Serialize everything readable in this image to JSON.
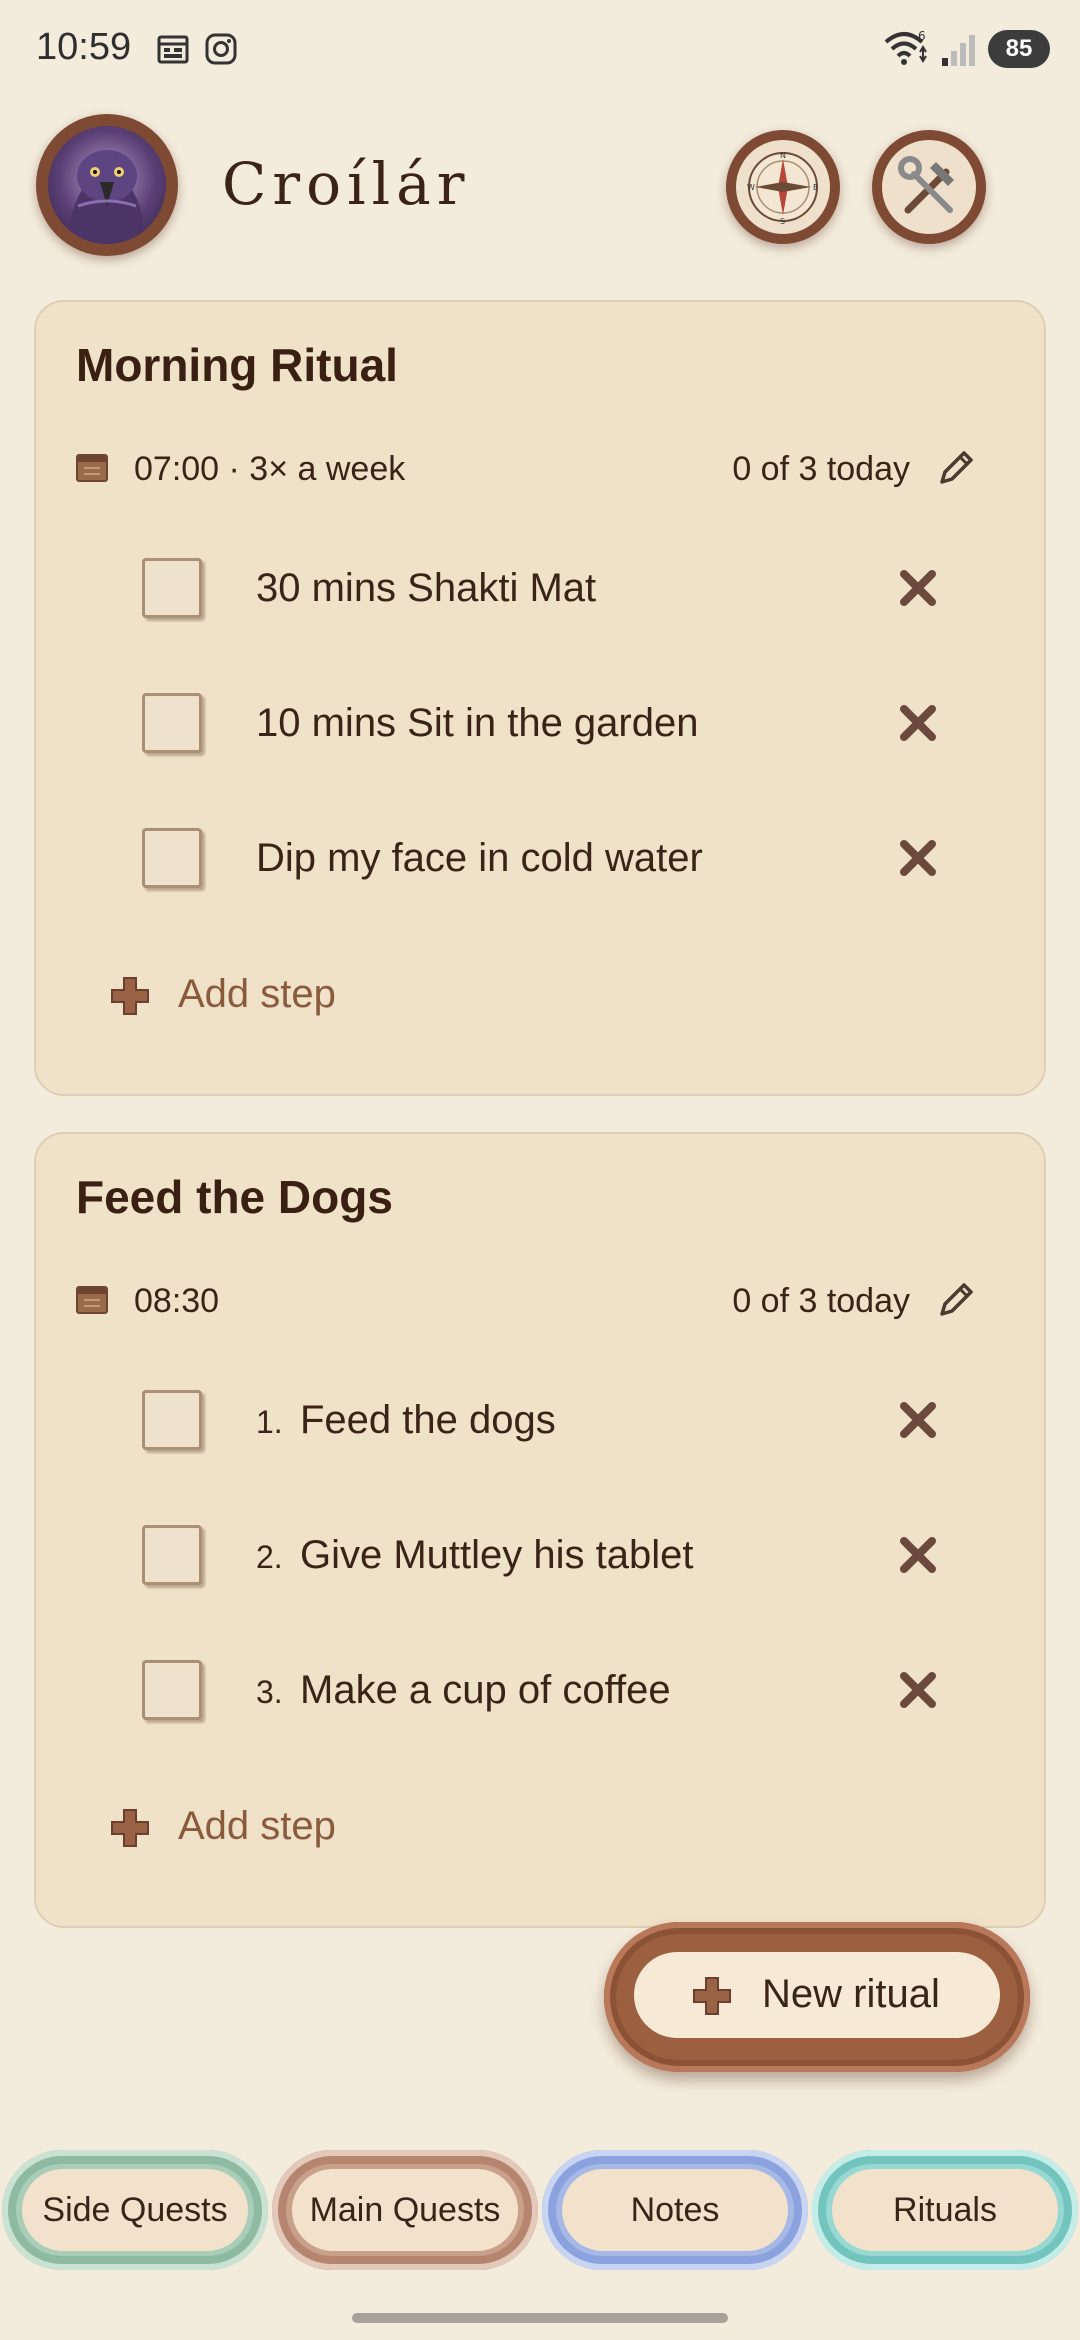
{
  "status_bar": {
    "time": "10:59",
    "battery": "85",
    "icons": [
      "calendar-icon",
      "instagram-icon",
      "wifi-icon",
      "signal-icon",
      "battery-icon"
    ]
  },
  "header": {
    "title": "Croílár",
    "avatar_icon": "raven-avatar-icon",
    "buttons": [
      {
        "icon": "compass-icon"
      },
      {
        "icon": "tools-icon"
      }
    ]
  },
  "rituals": [
    {
      "title": "Morning Ritual",
      "schedule": "07:00 · 3× a week",
      "progress": "0 of 3 today",
      "steps": [
        {
          "label": "30 mins Shakti Mat",
          "checked": false
        },
        {
          "label": "10 mins Sit in the garden",
          "checked": false
        },
        {
          "label": "Dip my face in cold water",
          "checked": false
        }
      ],
      "add_step_label": "Add step"
    },
    {
      "title": "Feed the Dogs",
      "schedule": "08:30",
      "progress": "0 of 3 today",
      "steps": [
        {
          "num": "1.",
          "label": "Feed the dogs",
          "checked": false
        },
        {
          "num": "2.",
          "label": "Give Muttley his tablet",
          "checked": false
        },
        {
          "num": "3.",
          "label": "Make a cup of coffee",
          "checked": false
        }
      ],
      "add_step_label": "Add step"
    }
  ],
  "new_ritual_label": "New ritual",
  "tabs": [
    {
      "label": "Side Quests"
    },
    {
      "label": "Main Quests"
    },
    {
      "label": "Notes"
    },
    {
      "label": "Rituals",
      "active": true
    }
  ],
  "colors": {
    "background": "#f3ebdc",
    "card": "#f0e2c8",
    "accent_brown": "#7e4a33",
    "text": "#3a2417"
  }
}
